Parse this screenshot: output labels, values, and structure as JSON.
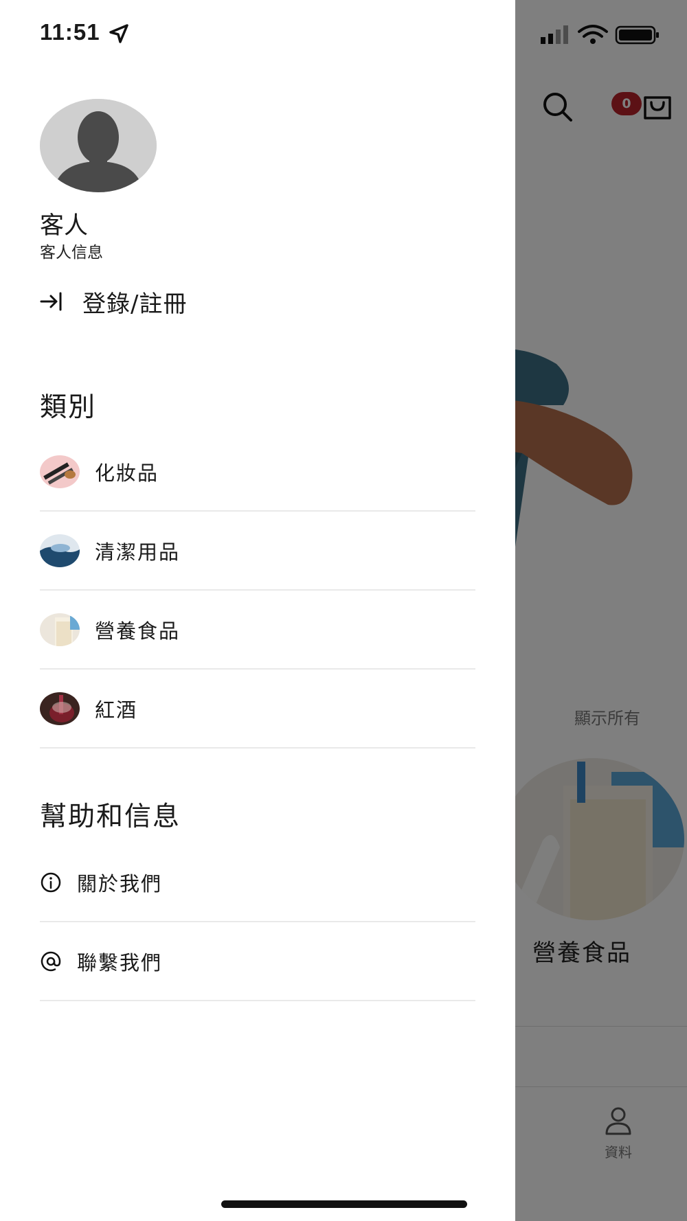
{
  "status_bar": {
    "time": "11:51"
  },
  "user": {
    "name": "客人",
    "info": "客人信息"
  },
  "auth": {
    "login_label": "登錄/註冊"
  },
  "categories": {
    "title": "類別",
    "items": [
      {
        "label": "化妝品"
      },
      {
        "label": "清潔用品"
      },
      {
        "label": "營養食品"
      },
      {
        "label": "紅酒"
      }
    ]
  },
  "help": {
    "title": "幫助和信息",
    "items": [
      {
        "label": "關於我們",
        "icon": "info-icon"
      },
      {
        "label": "聯繫我們",
        "icon": "at-icon"
      }
    ]
  },
  "background_app": {
    "cart_count": "0",
    "show_all": "顯示所有",
    "featured_category": "營養食品",
    "tab_profile": "資料"
  },
  "colors": {
    "badge": "#b8232a",
    "divider": "#e9e9e9",
    "overlay": "rgba(0,0,0,0.5)"
  }
}
